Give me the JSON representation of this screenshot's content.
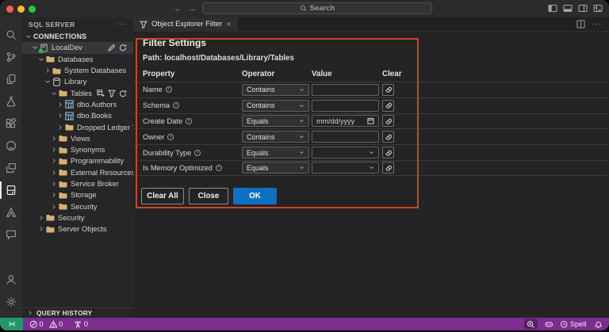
{
  "window": {
    "controls": [
      "close",
      "minimize",
      "maximize"
    ],
    "search_placeholder": "Search",
    "layout_icons": [
      "toggle-primary-sidebar-icon",
      "toggle-panel-icon",
      "toggle-secondary-sidebar-icon",
      "customize-layout-icon"
    ]
  },
  "activity_bar": {
    "icons": [
      "search-icon",
      "source-control-icon",
      "copy-files-icon",
      "beaker-icon",
      "extensions-icon",
      "github-icon",
      "remote-explorer-icon",
      "sql-server-icon",
      "azure-icon",
      "chat-icon",
      "account-icon",
      "settings-gear-icon"
    ],
    "active": "sql-server-icon"
  },
  "sidebar": {
    "title": "SQL SERVER",
    "more_label": "···",
    "tree": [
      {
        "label": "CONNECTIONS",
        "level": 0,
        "expanded": true,
        "icon": null
      },
      {
        "label": "LocalDev",
        "level": 1,
        "expanded": true,
        "icon": "server-icon",
        "selected": true,
        "actions": [
          "edit-pencil-icon",
          "refresh-icon"
        ]
      },
      {
        "label": "Databases",
        "level": 2,
        "expanded": true,
        "icon": "folder-icon"
      },
      {
        "label": "System Databases",
        "level": 3,
        "expanded": false,
        "icon": "folder-icon"
      },
      {
        "label": "Library",
        "level": 3,
        "expanded": true,
        "icon": "database-icon"
      },
      {
        "label": "Tables",
        "level": 4,
        "expanded": true,
        "icon": "folder-icon",
        "actions": [
          "new-table-icon",
          "filter-icon",
          "refresh-icon"
        ]
      },
      {
        "label": "dbo.Authors",
        "level": 5,
        "expanded": false,
        "icon": "table-icon"
      },
      {
        "label": "dbo.Books",
        "level": 5,
        "expanded": false,
        "icon": "table-icon"
      },
      {
        "label": "Dropped Ledger Tables",
        "level": 5,
        "expanded": false,
        "icon": "folder-icon"
      },
      {
        "label": "Views",
        "level": 4,
        "expanded": false,
        "icon": "folder-icon"
      },
      {
        "label": "Synonyms",
        "level": 4,
        "expanded": false,
        "icon": "folder-icon"
      },
      {
        "label": "Programmability",
        "level": 4,
        "expanded": false,
        "icon": "folder-icon"
      },
      {
        "label": "External Resources",
        "level": 4,
        "expanded": false,
        "icon": "folder-icon"
      },
      {
        "label": "Service Broker",
        "level": 4,
        "expanded": false,
        "icon": "folder-icon"
      },
      {
        "label": "Storage",
        "level": 4,
        "expanded": false,
        "icon": "folder-icon"
      },
      {
        "label": "Security",
        "level": 4,
        "expanded": false,
        "icon": "folder-icon"
      },
      {
        "label": "Security",
        "level": 2,
        "expanded": false,
        "icon": "folder-icon"
      },
      {
        "label": "Server Objects",
        "level": 2,
        "expanded": false,
        "icon": "folder-icon"
      }
    ],
    "query_history_label": "QUERY HISTORY"
  },
  "editor": {
    "tab": {
      "label": "Object Explorer Filter",
      "icon": "filter-icon",
      "close": "×"
    },
    "panel": {
      "title": "Filter Settings",
      "path": "Path: localhost/Databases/Library/Tables",
      "columns": [
        "Property",
        "Operator",
        "Value",
        "Clear"
      ],
      "rows": [
        {
          "property": "Name",
          "operator": "Contains",
          "value": "",
          "control": "text"
        },
        {
          "property": "Schema",
          "operator": "Contains",
          "value": "",
          "control": "text"
        },
        {
          "property": "Create Date",
          "operator": "Equals",
          "value": "mm/dd/yyyy",
          "control": "date"
        },
        {
          "property": "Owner",
          "operator": "Contains",
          "value": "",
          "control": "text"
        },
        {
          "property": "Durability Type",
          "operator": "Equals",
          "value": "",
          "control": "select"
        },
        {
          "property": "Is Memory Optimized",
          "operator": "Equals",
          "value": "",
          "control": "select"
        }
      ],
      "buttons": {
        "clear_all": "Clear All",
        "close": "Close",
        "ok": "OK"
      }
    }
  },
  "status_bar": {
    "remote_icon": "remote-indicator-icon",
    "errors": "0",
    "warnings": "0",
    "ports": "0",
    "spell_label": "Spell",
    "right_icons": [
      "zoom-in-icon",
      "copilot-icon",
      "spell-checker-icon",
      "bell-icon"
    ]
  },
  "colors": {
    "status_bar": "#7c2d8e",
    "remote_item": "#20996a",
    "ok_button": "#0e70c2",
    "annotation_border": "#cd4527",
    "folder_icon": "#d7b073",
    "traffic_lights": [
      "#ff5f57",
      "#febc2e",
      "#28c840"
    ]
  }
}
